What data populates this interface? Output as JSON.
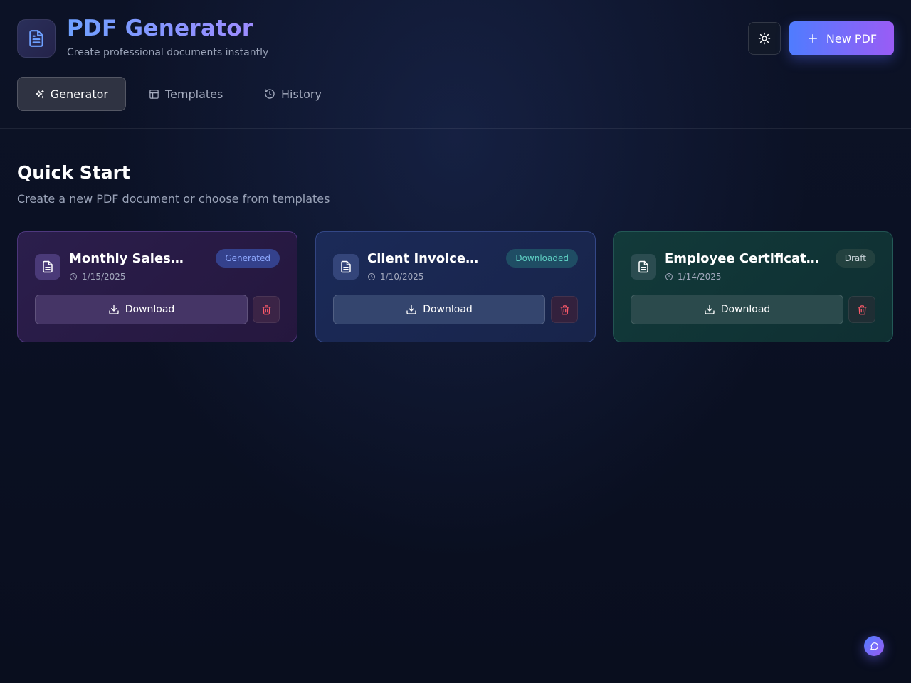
{
  "app": {
    "title": "PDF Generator",
    "subtitle": "Create professional documents instantly"
  },
  "header": {
    "theme_icon": "sun-icon",
    "new_pdf_label": "New PDF"
  },
  "tabs": [
    {
      "label": "Generator",
      "icon": "sparkles-icon",
      "active": true
    },
    {
      "label": "Templates",
      "icon": "layout-icon",
      "active": false
    },
    {
      "label": "History",
      "icon": "history-icon",
      "active": false
    }
  ],
  "section": {
    "title": "Quick Start",
    "subtitle": "Create a new PDF document or choose from templates"
  },
  "documents": [
    {
      "title": "Monthly Sales…",
      "date": "1/15/2025",
      "status": "Generated",
      "download_label": "Download",
      "accent": "#8fa9ff"
    },
    {
      "title": "Client Invoice…",
      "date": "1/10/2025",
      "status": "Downloaded",
      "download_label": "Download",
      "accent": "#5fd1c4"
    },
    {
      "title": "Employee Certificat…",
      "date": "1/14/2025",
      "status": "Draft",
      "download_label": "Download",
      "accent": "#c9d3d8"
    }
  ],
  "colors": {
    "primary_gradient_start": "#4f7cff",
    "primary_gradient_end": "#9a5cf5",
    "delete": "#ff5a6a",
    "background": "#0b1020"
  }
}
